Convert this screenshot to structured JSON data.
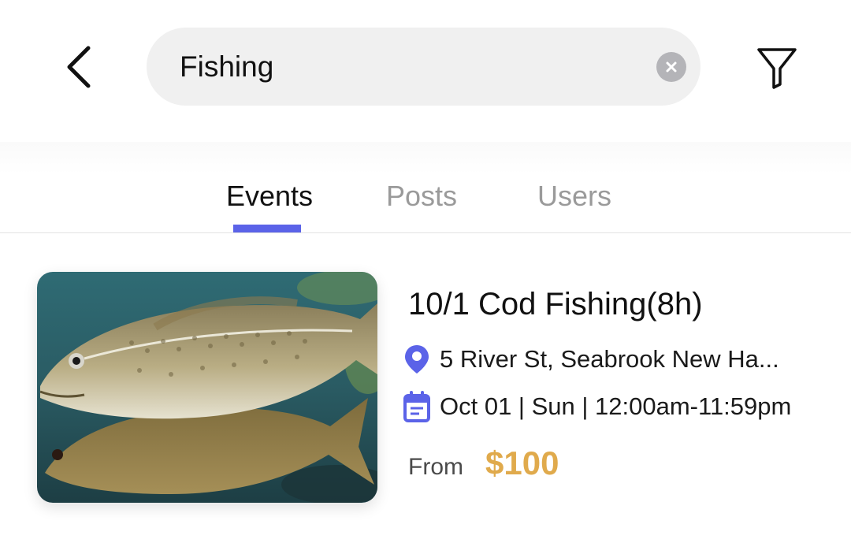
{
  "search": {
    "query": "Fishing"
  },
  "tabs": [
    {
      "label": "Events"
    },
    {
      "label": "Posts"
    },
    {
      "label": "Users"
    }
  ],
  "active_tab": "Events",
  "colors": {
    "accent": "#5b63e8",
    "price": "#e0aa4c",
    "inactive_tab": "#9a9a9a"
  },
  "icons": {
    "back": "chevron-left-icon",
    "clear": "clear-icon",
    "filter": "filter-icon",
    "location": "location-pin-icon",
    "date": "calendar-icon"
  },
  "events": [
    {
      "title": "10/1 Cod Fishing(8h)",
      "location": "5 River St, Seabrook New Ha...",
      "datetime": "Oct 01 | Sun | 12:00am-11:59pm",
      "price_prefix": "From",
      "price": "$100"
    }
  ]
}
